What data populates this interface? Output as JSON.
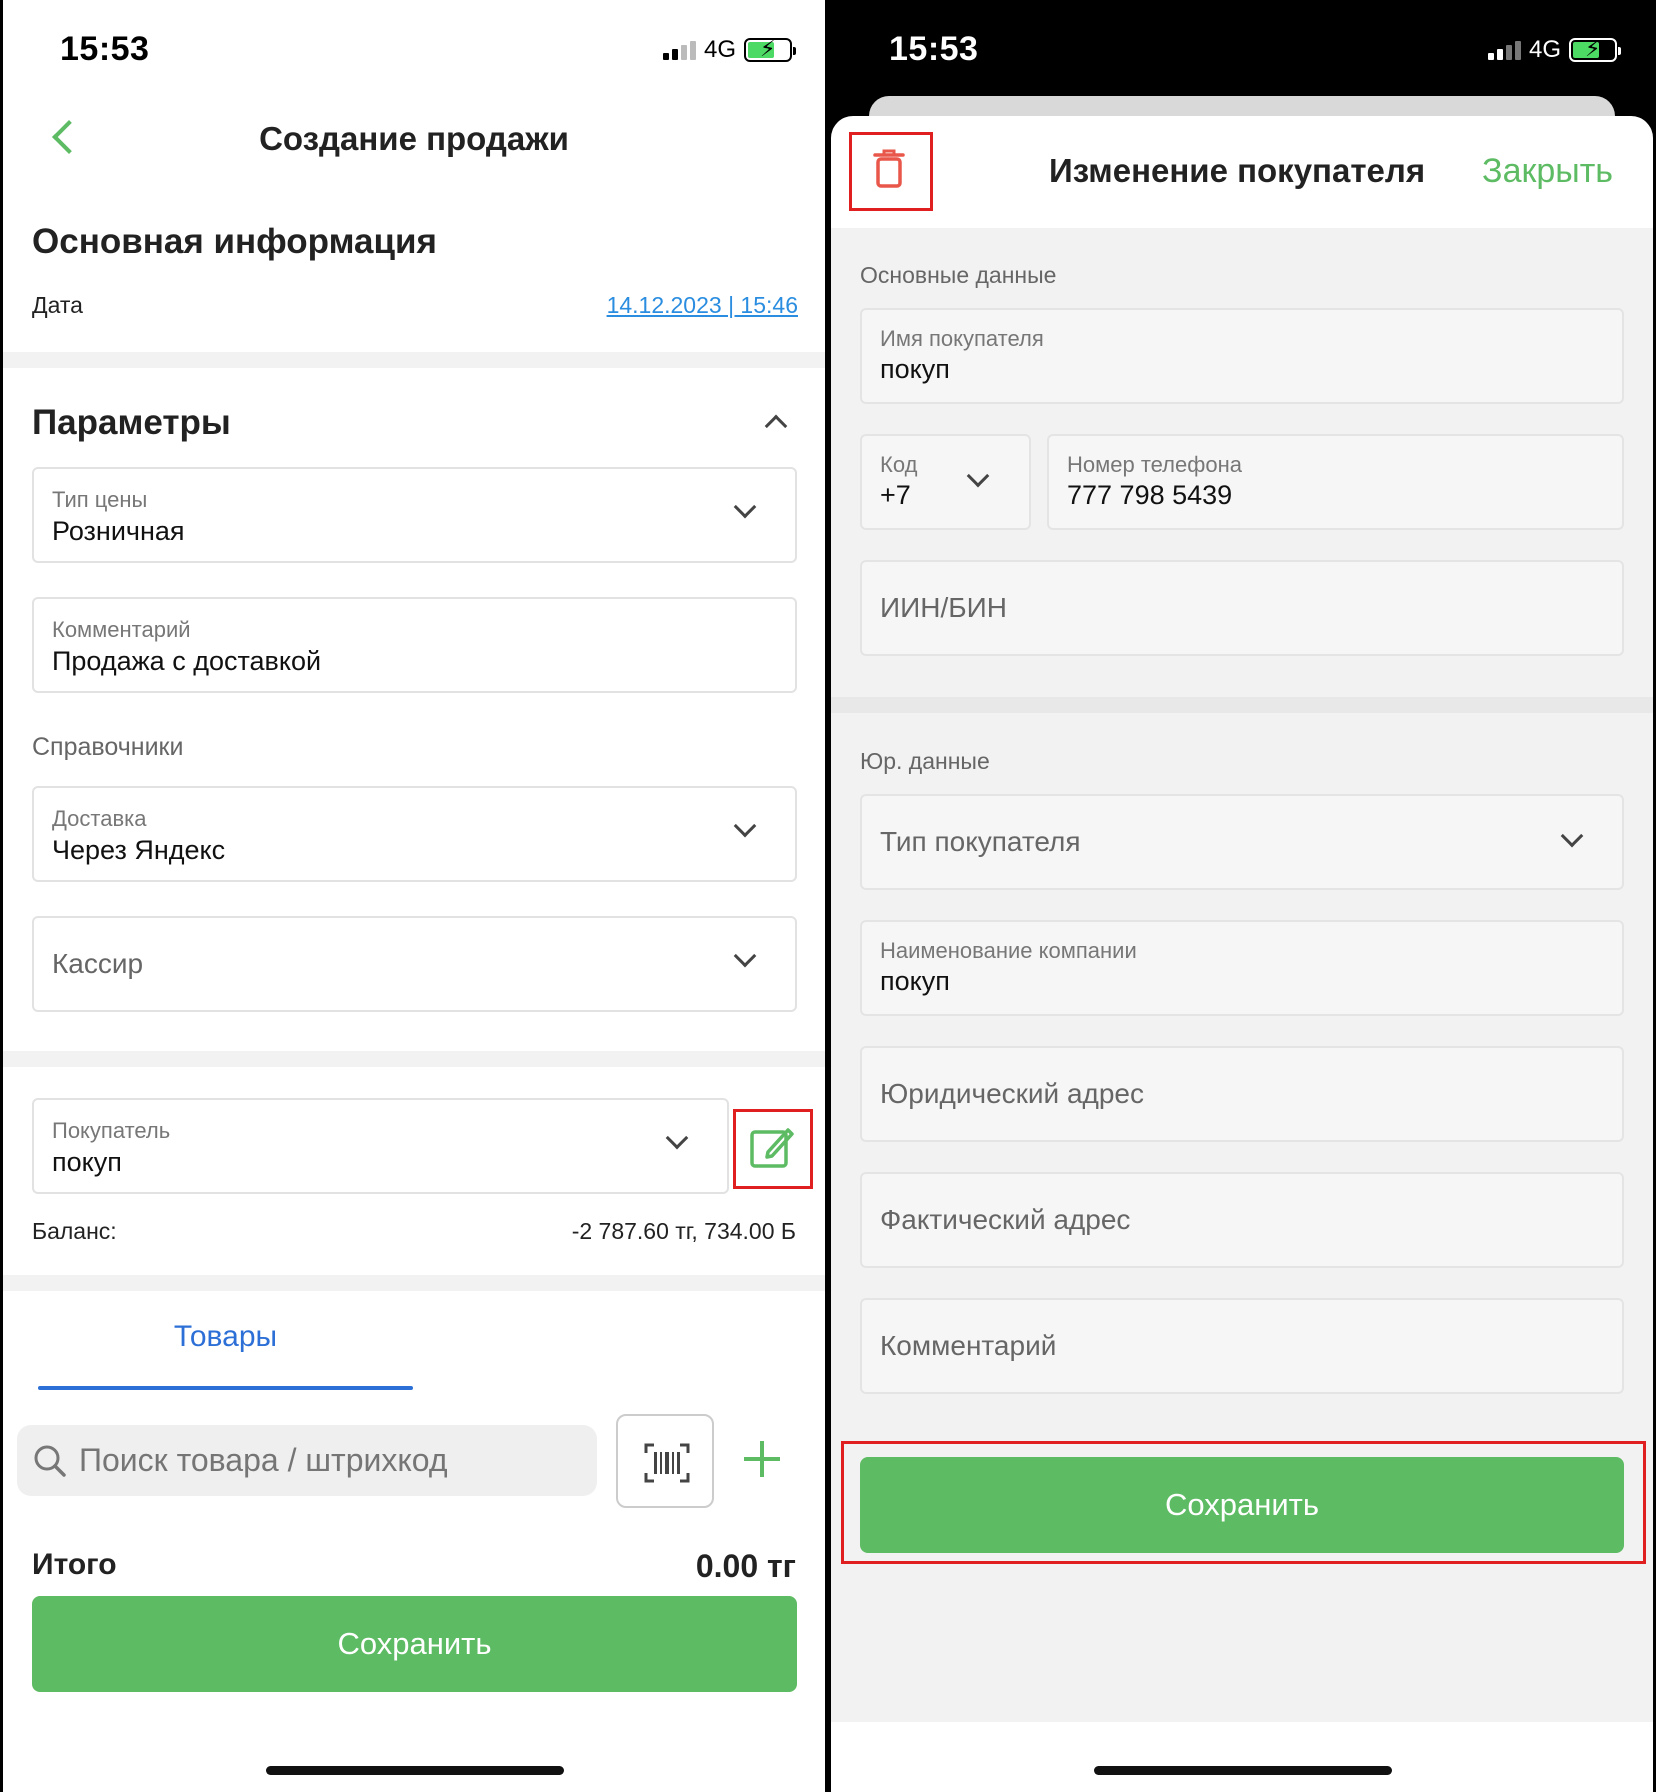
{
  "status": {
    "time": "15:53",
    "network": "4G"
  },
  "left": {
    "title": "Создание продажи",
    "main_section": "Основная информация",
    "date_label": "Дата",
    "date_value": "14.12.2023 | 15:46",
    "params_section": "Параметры",
    "price_type": {
      "label": "Тип цены",
      "value": "Розничная"
    },
    "comment": {
      "label": "Комментарий",
      "value": "Продажа с доставкой"
    },
    "directories": "Справочники",
    "delivery": {
      "label": "Доставка",
      "value": "Через Яндекс"
    },
    "cashier": {
      "placeholder": "Кассир"
    },
    "buyer": {
      "label": "Покупатель",
      "value": "покуп"
    },
    "balance_label": "Баланс:",
    "balance_value": "-2 787.60 тг, 734.00 Б",
    "tab_goods": "Товары",
    "search_placeholder": "Поиск товара / штрихкод",
    "total_label": "Итого",
    "total_value": "0.00 тг",
    "save": "Сохранить"
  },
  "right": {
    "title": "Изменение покупателя",
    "close": "Закрыть",
    "basic_section": "Основные данные",
    "buyer_name": {
      "label": "Имя покупателя",
      "value": "покуп"
    },
    "code": {
      "label": "Код",
      "value": "+7"
    },
    "phone": {
      "label": "Номер телефона",
      "value": "777 798 5439"
    },
    "iin_placeholder": "ИИН/БИН",
    "legal_section": "Юр. данные",
    "buyer_type_placeholder": "Тип покупателя",
    "company": {
      "label": "Наименование компании",
      "value": "покуп"
    },
    "legal_address_placeholder": "Юридический адрес",
    "actual_address_placeholder": "Фактический адрес",
    "comment_placeholder": "Комментарий",
    "save": "Сохранить"
  },
  "colors": {
    "accent_green": "#5dbb63",
    "link_blue": "#2a8de0",
    "tab_blue": "#2c6fd6",
    "highlight_red": "#e02020"
  }
}
